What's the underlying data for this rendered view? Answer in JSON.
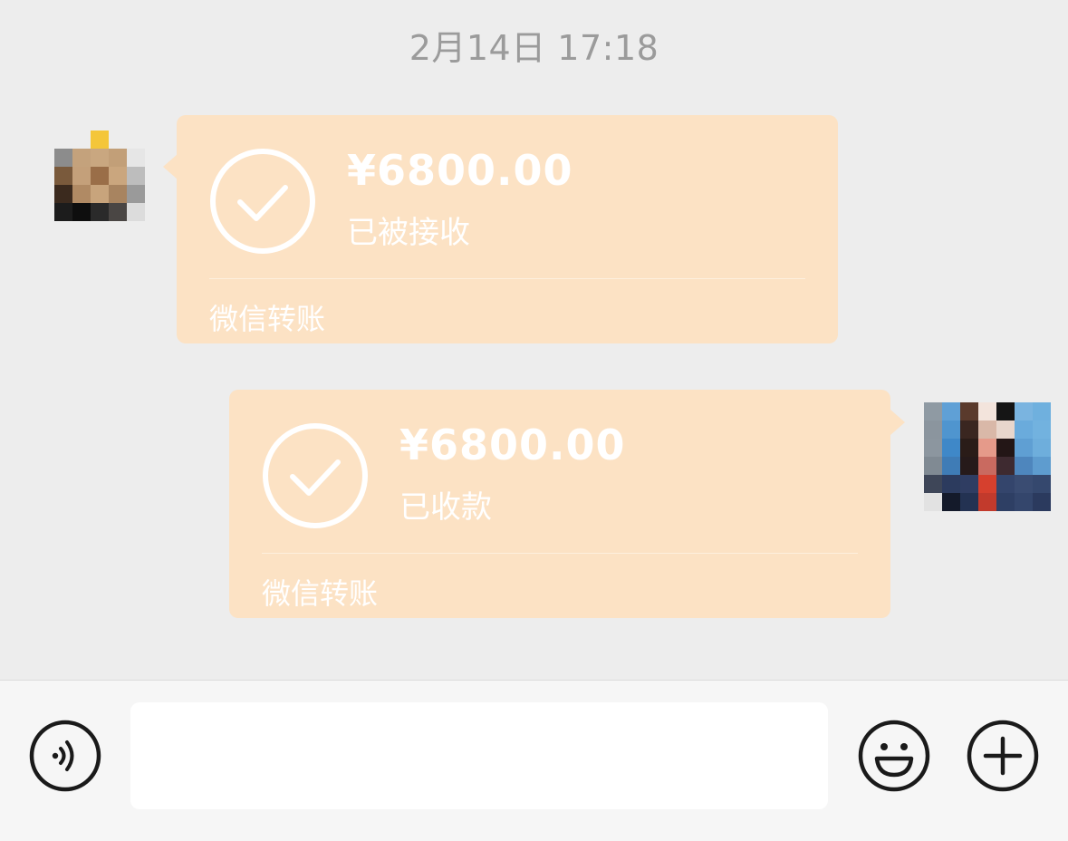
{
  "chat": {
    "timestamp": "2月14日 17:18",
    "messages": [
      {
        "side": "incoming",
        "amount": "¥6800.00",
        "status": "已被接收",
        "footer": "微信转账"
      },
      {
        "side": "outgoing",
        "amount": "¥6800.00",
        "status": "已收款",
        "footer": "微信转账"
      }
    ]
  },
  "input_bar": {
    "voice_icon": "voice-icon",
    "emoji_icon": "emoji-icon",
    "plus_icon": "plus-icon",
    "text_value": ""
  },
  "colors": {
    "background": "#ededed",
    "card": "#fce2c4",
    "input_bar": "#f6f6f6",
    "icon_stroke": "#1a1a1a"
  }
}
